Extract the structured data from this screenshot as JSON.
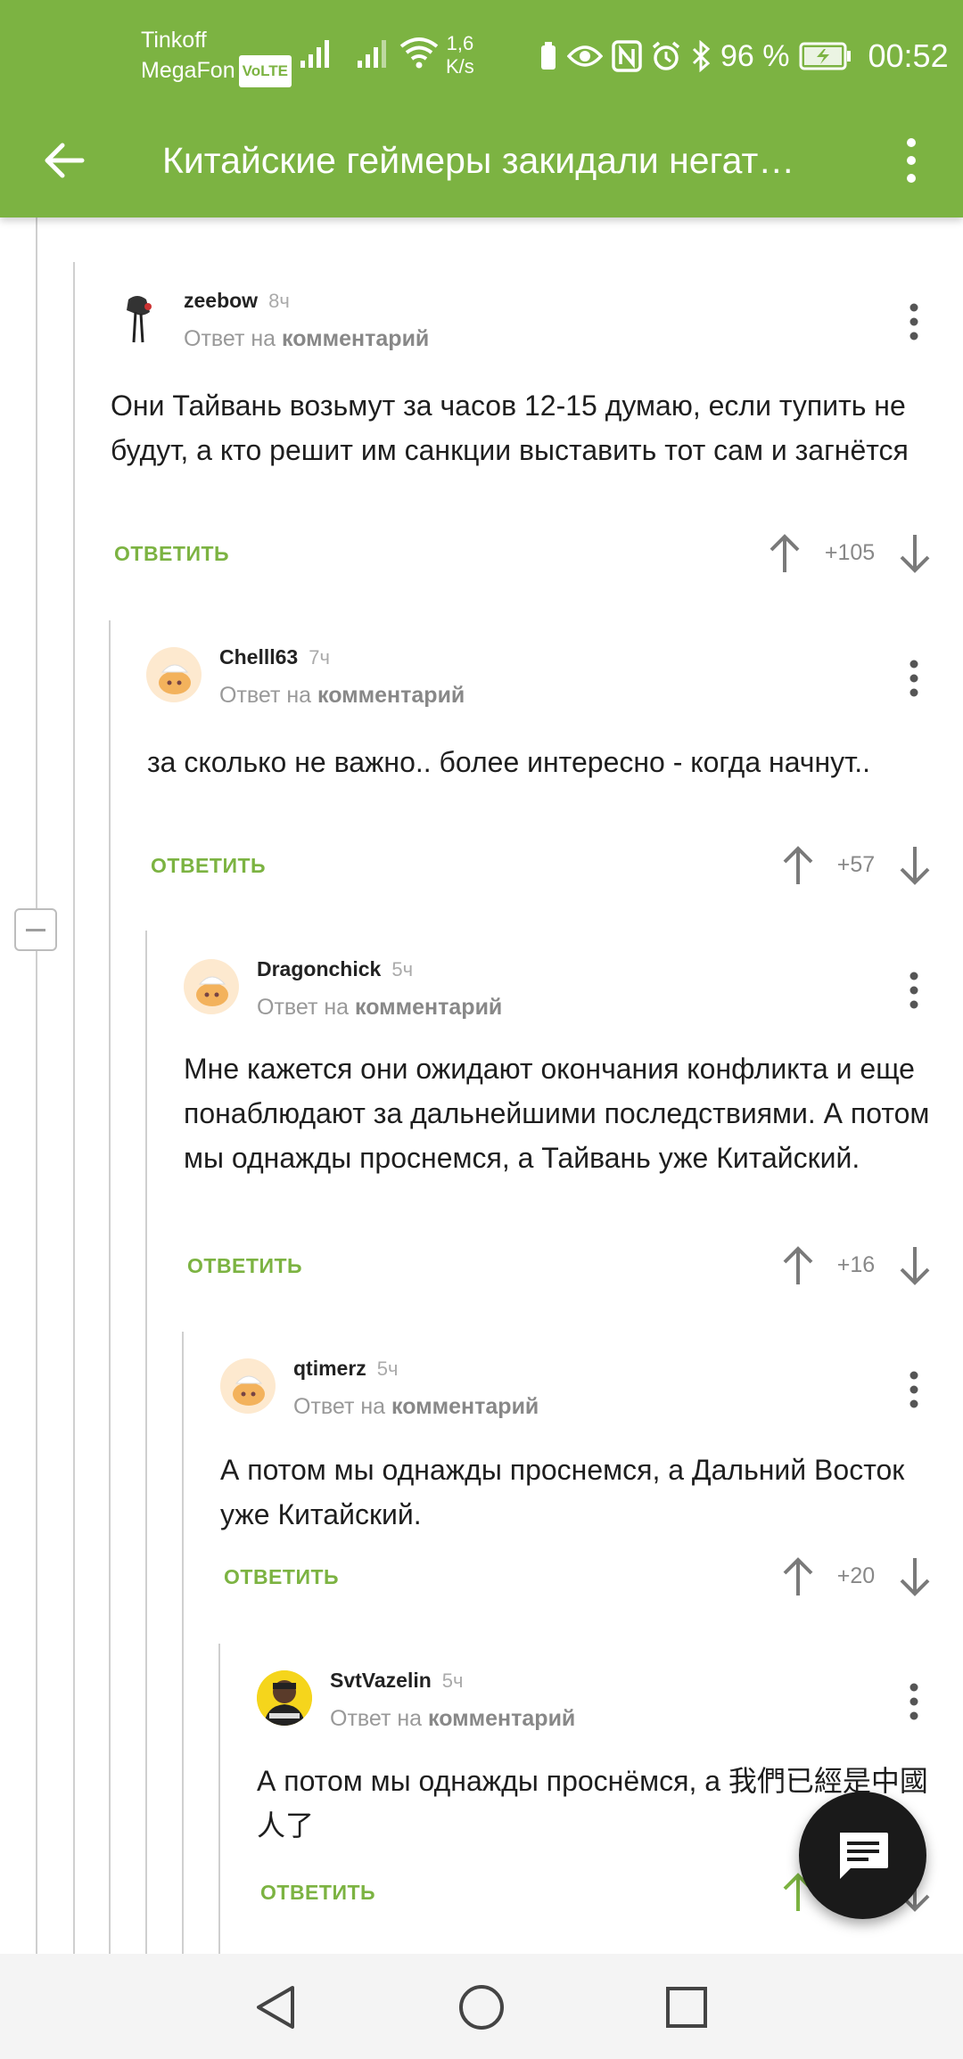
{
  "status_bar": {
    "carrier_1": "Tinkoff",
    "carrier_2": "MegaFon",
    "volte": "VoLTE",
    "speed_value": "1,6",
    "speed_unit": "K/s",
    "battery": "96 %",
    "time": "00:52"
  },
  "app_bar": {
    "title": "Китайские геймеры закидали негат…"
  },
  "comments": [
    {
      "author": "zeebow",
      "time": "8ч",
      "reply_prefix": "Ответ на",
      "reply_target": "комментарий",
      "text": "Они Тайвань возьмут за часов 12-15 думаю, если тупить не будут, а кто решит им санкции выставить тот сам и загнётся",
      "reply_label": "ОТВЕТИТЬ",
      "score": "+105"
    },
    {
      "author": "Chelll63",
      "time": "7ч",
      "reply_prefix": "Ответ на",
      "reply_target": "комментарий",
      "text": "за сколько не важно.. более интересно - когда начнут..",
      "reply_label": "ОТВЕТИТЬ",
      "score": "+57"
    },
    {
      "author": "Dragonchick",
      "time": "5ч",
      "reply_prefix": "Ответ на",
      "reply_target": "комментарий",
      "text": "Мне кажется они ожидают окончания конфликта и еще понаблюдают за дальнейшими последствиями. А потом мы однажды проснемся, а Тайвань уже Китайский.",
      "reply_label": "ОТВЕТИТЬ",
      "score": "+16"
    },
    {
      "author": "qtimerz",
      "time": "5ч",
      "reply_prefix": "Ответ на",
      "reply_target": "комментарий",
      "text": "А потом мы однажды проснемся, а Дальний Восток уже Китайский.",
      "reply_label": "ОТВЕТИТЬ",
      "score": "+20"
    },
    {
      "author": "SvtVazelin",
      "time": "5ч",
      "reply_prefix": "Ответ на",
      "reply_target": "комментарий",
      "text": "А потом мы однажды проснёмся, а 我們已經是中國人了",
      "reply_label": "ОТВЕТИТЬ",
      "score": ""
    }
  ],
  "colors": {
    "accent": "#7cb342",
    "fab": "#1a1a1a"
  },
  "icons": {
    "back": "arrow-left-icon",
    "more": "more-vertical-icon",
    "upvote": "arrow-up-icon",
    "downvote": "arrow-down-icon",
    "fab": "comment-icon"
  }
}
